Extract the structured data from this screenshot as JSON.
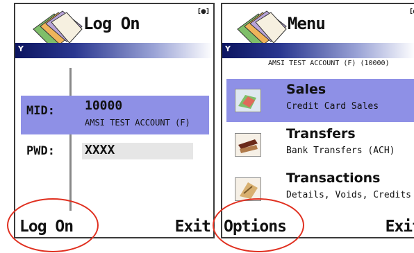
{
  "left_screen": {
    "title": "Log On",
    "mid": {
      "label": "MID:",
      "value": "10000",
      "account": "AMSI TEST ACCOUNT (F)"
    },
    "pwd": {
      "label": "PWD:",
      "value": "XXXX"
    },
    "softkeys": {
      "left": "Log On",
      "right": "Exit"
    }
  },
  "right_screen": {
    "title": "Menu",
    "account_line": "AMSI TEST ACCOUNT (F) (10000)",
    "items": [
      {
        "label": "Sales",
        "subtitle": "Credit Card Sales",
        "icon": "sales-icon"
      },
      {
        "label": "Transfers",
        "subtitle": "Bank Transfers (ACH)",
        "icon": "transfers-icon"
      },
      {
        "label": "Transactions",
        "subtitle": "Details, Voids, Credits",
        "icon": "transactions-icon"
      }
    ],
    "softkeys": {
      "left": "Options",
      "right": "Exit"
    }
  },
  "colors": {
    "selection": "#8e90e6",
    "highlight_circle": "#e03020",
    "band_dark": "#0c1560"
  }
}
